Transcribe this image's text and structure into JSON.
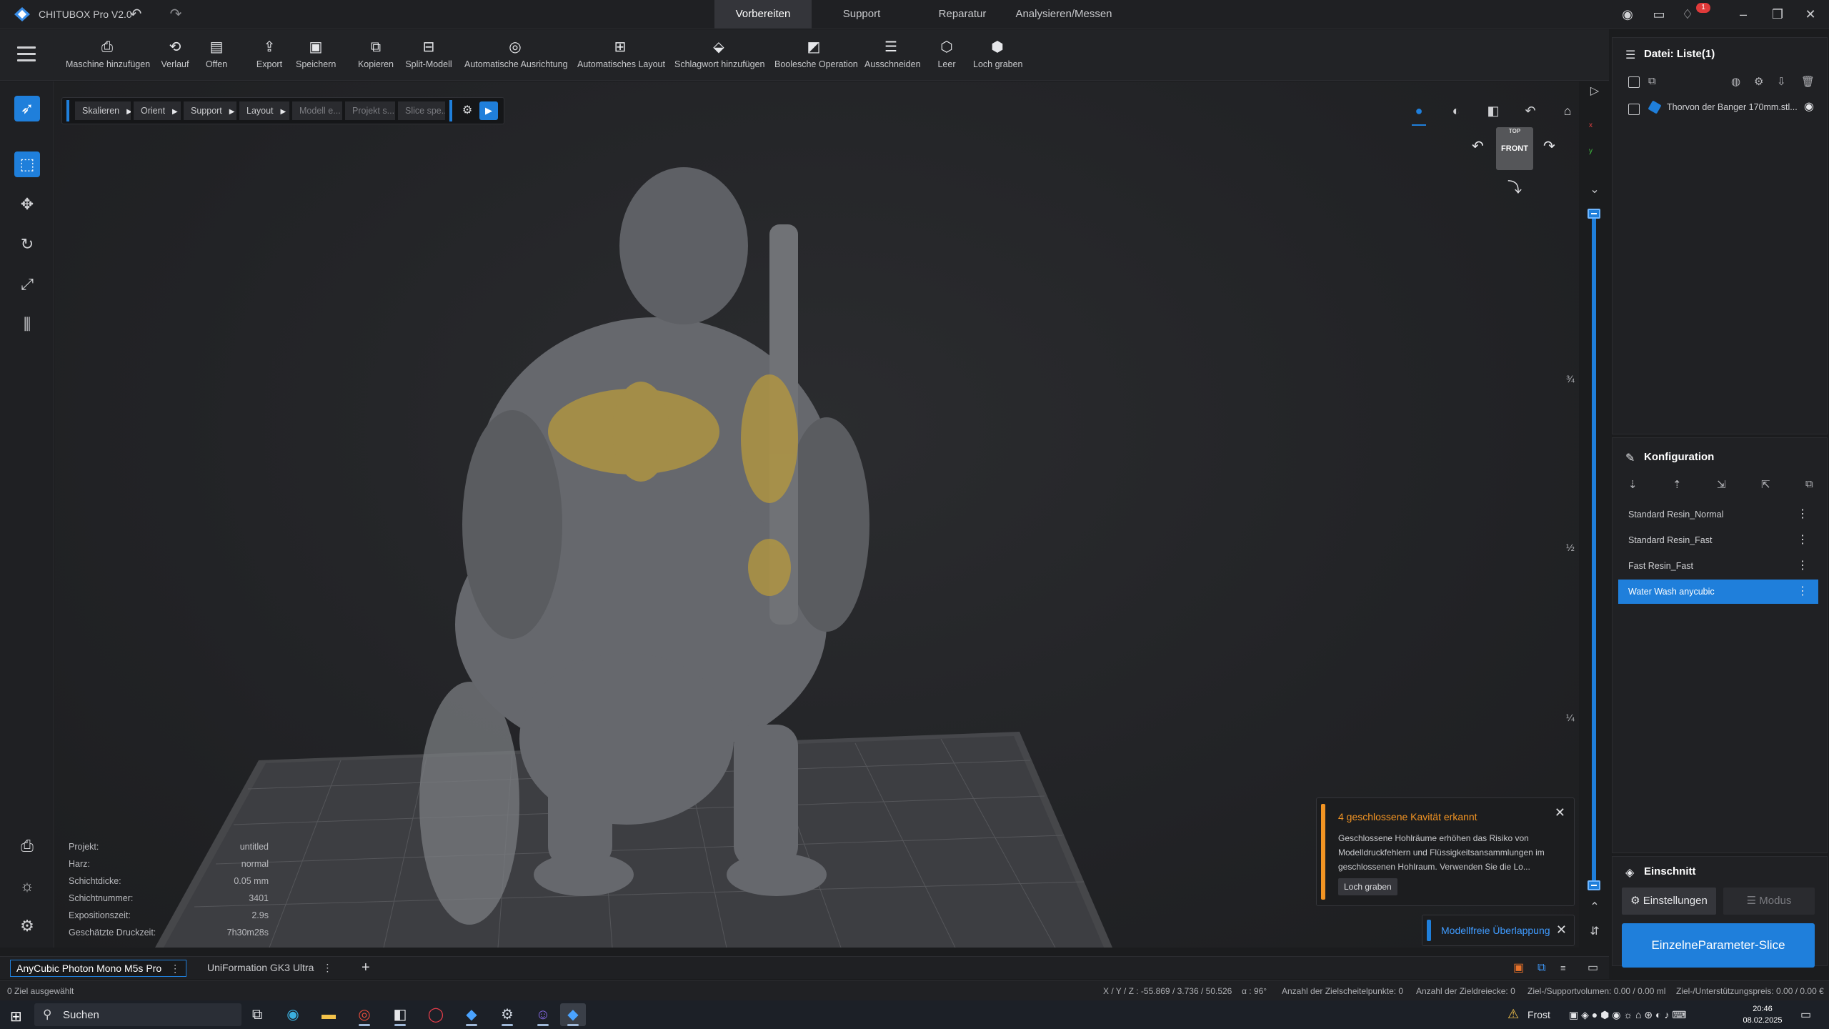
{
  "app": {
    "title": "CHITUBOX Pro V2.0"
  },
  "main_tabs": [
    "Vorbereiten",
    "Support",
    "Reparatur",
    "Analysieren/Messen"
  ],
  "notification_count": "1",
  "toolbar": {
    "items": [
      {
        "label": "Maschine hinzufügen",
        "icon": "printer-add-icon"
      },
      {
        "label": "Verlauf",
        "icon": "history-icon"
      },
      {
        "label": "Offen",
        "icon": "folder-open-icon"
      },
      {
        "label": "Export",
        "icon": "export-icon"
      },
      {
        "label": "Speichern",
        "icon": "save-icon"
      },
      {
        "label": "Kopieren",
        "icon": "copy-icon"
      },
      {
        "label": "Split-Modell",
        "icon": "split-icon"
      },
      {
        "label": "Automatische Ausrichtung",
        "icon": "auto-orient-icon"
      },
      {
        "label": "Automatisches Layout",
        "icon": "auto-layout-icon"
      },
      {
        "label": "Schlagwort hinzufügen",
        "icon": "tag-icon"
      },
      {
        "label": "Boolesche Operation",
        "icon": "boolean-icon"
      },
      {
        "label": "Ausschneiden",
        "icon": "cut-icon"
      },
      {
        "label": "Leer",
        "icon": "hollow-icon"
      },
      {
        "label": "Loch graben",
        "icon": "dig-hole-icon"
      }
    ]
  },
  "workflow": {
    "steps": [
      {
        "label": "Skalieren",
        "dim": false
      },
      {
        "label": "Orient",
        "dim": false
      },
      {
        "label": "Support",
        "dim": false
      },
      {
        "label": "Layout",
        "dim": false
      },
      {
        "label": "Modell e...",
        "dim": true
      },
      {
        "label": "Projekt s...",
        "dim": true
      },
      {
        "label": "Slice spe...",
        "dim": true
      }
    ]
  },
  "navcube": {
    "top": "TOP",
    "front": "FRONT"
  },
  "layer_slider": {
    "lower": 0.0,
    "upper": 1.0,
    "marks": [
      "¾",
      "½",
      "¼"
    ]
  },
  "stats": [
    {
      "label": "Projekt:",
      "value": "untitled"
    },
    {
      "label": "Harz:",
      "value": "normal"
    },
    {
      "label": "Schichtdicke:",
      "value": "0.05 mm"
    },
    {
      "label": "Schichtnummer:",
      "value": "3401"
    },
    {
      "label": "Expositionszeit:",
      "value": "2.9s"
    },
    {
      "label": "Geschätzte Druckzeit:",
      "value": "7h30m28s"
    }
  ],
  "notification": {
    "title": "4 geschlossene Kavität erkannt",
    "body": "Geschlossene Hohlräume erhöhen das Risiko von Modelldruckfehlern und Flüssigkeitsansammlungen im geschlossenen Hohlraum. Verwenden Sie die Lo...",
    "button": "Loch graben"
  },
  "notification_small": {
    "text": "Modellfreie Überlappung"
  },
  "machines": [
    {
      "name": "AnyCubic Photon Mono M5s Pro",
      "active": true
    },
    {
      "name": "UniFormation GK3 Ultra",
      "active": false
    }
  ],
  "statusbar": {
    "selection": "0 Ziel ausgewählt",
    "coords": "X / Y / Z :  -55.869 / 3.736 / 50.526",
    "alpha": "α :  96°",
    "vertices": "Anzahl der Zielscheitelpunkte:  0",
    "triangles": "Anzahl der Zieldreiecke:  0",
    "support_volume": "Ziel-/Supportvolumen:  0.00 / 0.00 ml",
    "price": "Ziel-/Unterstützungspreis:  0.00 / 0.00 €"
  },
  "file_panel": {
    "title": "Datei: Liste(1)",
    "files": [
      "Thorvon der Banger 170mm.stl..."
    ]
  },
  "config_panel": {
    "title": "Konfiguration",
    "profiles": [
      "Standard Resin_Normal",
      "Standard Resin_Fast",
      "Fast Resin_Fast",
      "Water Wash anycubic"
    ],
    "selected_index": 3
  },
  "slice_panel": {
    "title": "Einschnitt",
    "settings_tab": "Einstellungen",
    "mode_tab": "Modus",
    "slice_button": "EinzelneParameter-Slice"
  },
  "taskbar": {
    "search": "Suchen",
    "weather": "Frost",
    "time": "20:46",
    "date": "08.02.2025"
  },
  "colors": {
    "accent": "#1f7fdb",
    "warning": "#f29423",
    "model": "#6e7075",
    "highlight": "#b89a3c"
  }
}
